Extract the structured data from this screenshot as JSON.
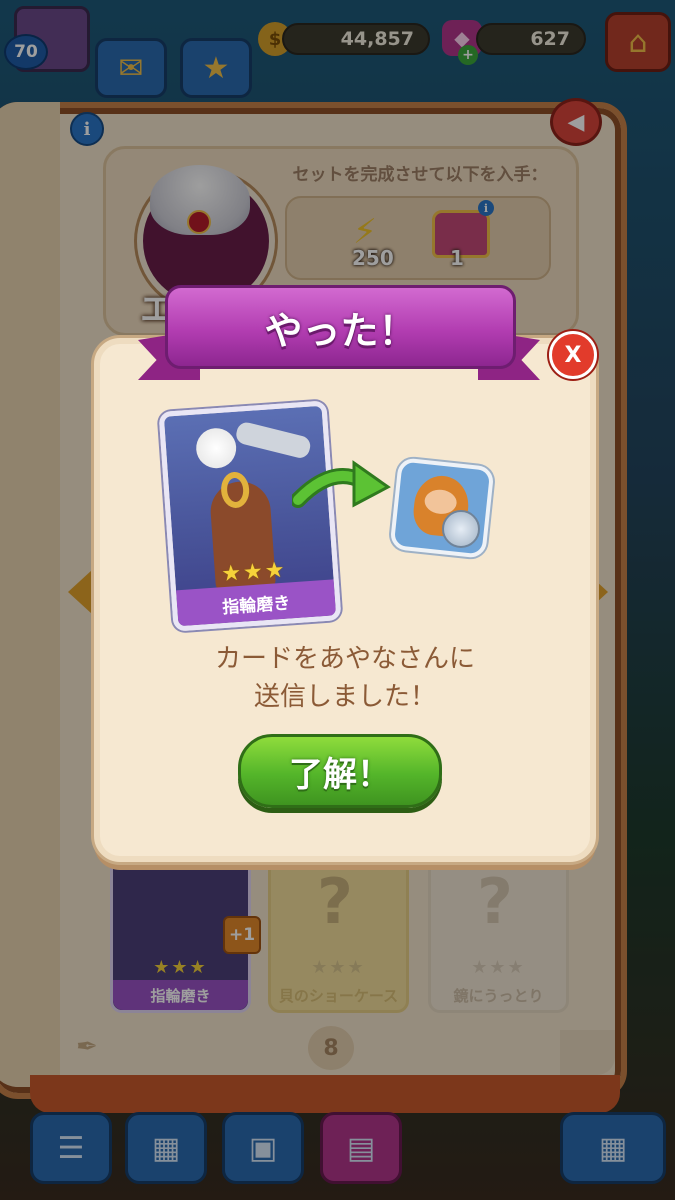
{
  "hud": {
    "level": "70",
    "coins": "44,857",
    "gems": "627"
  },
  "book": {
    "reward_title": "セットを完成させて以下を入手：",
    "rewards": [
      {
        "icon": "lightning-icon",
        "value": "250"
      },
      {
        "icon": "chest-icon",
        "value": "1"
      }
    ],
    "set_name_partial": "エ",
    "page_number": "8",
    "cards": [
      {
        "label": "指輪磨き",
        "stars": 3,
        "owned": true,
        "badge": "+1"
      },
      {
        "label": "貝のショーケース",
        "stars": 3,
        "owned": false
      },
      {
        "label": "鏡にうっとり",
        "stars": 3,
        "owned": false
      }
    ]
  },
  "modal": {
    "title": "やった！",
    "card_label": "指輪磨き",
    "card_stars": "★★★",
    "message_line1": "カードをあやなさんに",
    "message_line2": "送信しました！",
    "ok_button": "了解！"
  },
  "colors": {
    "ribbon": "#b23db1",
    "ok_button": "#54b52a",
    "close_button": "#e23b2b",
    "message_text": "#8b5a36"
  }
}
